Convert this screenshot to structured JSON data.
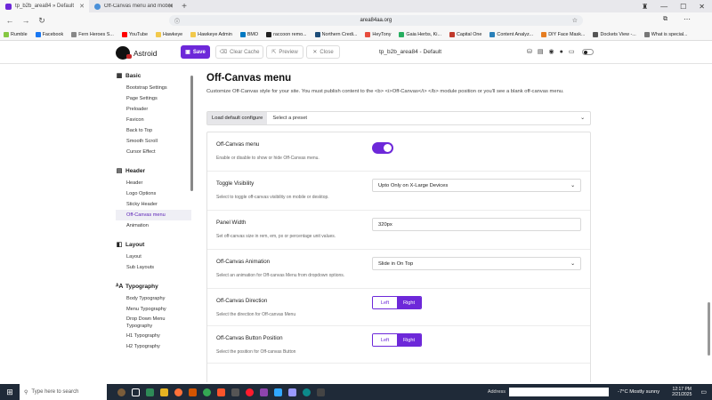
{
  "browser": {
    "tabs": [
      {
        "label": "tp_b2b_area84 » Default",
        "favicon_color": "#6d28d9",
        "active": true
      },
      {
        "label": "Off-Canvas menu and mobile menu...",
        "favicon_color": "#4a90d9",
        "active": false
      }
    ],
    "new_tab": "+",
    "url": "area84aa.org",
    "bookmarks": [
      {
        "label": "Rumble",
        "color": "#85c742"
      },
      {
        "label": "Facebook",
        "color": "#1877f2"
      },
      {
        "label": "Fern Heroes S...",
        "color": "#888888"
      },
      {
        "label": "YouTube",
        "color": "#ff0000"
      },
      {
        "label": "Hawkeye",
        "color": "#f2c94c"
      },
      {
        "label": "Hawkeye Admin",
        "color": "#f2c94c"
      },
      {
        "label": "BMO",
        "color": "#0079c1"
      },
      {
        "label": "raccoon remo...",
        "color": "#222222"
      },
      {
        "label": "Northern Credi...",
        "color": "#1f4e79"
      },
      {
        "label": "HeyTony",
        "color": "#e74c3c"
      },
      {
        "label": "Gaia Herbs, Ki...",
        "color": "#27ae60"
      },
      {
        "label": "Capital One",
        "color": "#c0392b"
      },
      {
        "label": "Content Analyz...",
        "color": "#2980b9"
      },
      {
        "label": "DIY Face Mask...",
        "color": "#e67e22"
      },
      {
        "label": "Dockets View -...",
        "color": "#555555"
      },
      {
        "label": "What is special...",
        "color": "#777777"
      }
    ]
  },
  "app": {
    "logo_text": "Astroid",
    "save_label": "Save",
    "clear_cache_label": "Clear Cache",
    "preview_label": "Preview",
    "close_label": "Close",
    "site_title": "tp_b2b_area84 - Default"
  },
  "sidebar": {
    "groups": [
      {
        "title": "Basic",
        "icon": "sliders-icon",
        "glyph": "▦",
        "items": [
          "Bootstrap Settings",
          "Page Settings",
          "Preloader",
          "Favicon",
          "Back to Top",
          "Smooth Scroll",
          "Cursor Effect"
        ]
      },
      {
        "title": "Header",
        "icon": "header-icon",
        "glyph": "▤",
        "items": [
          "Header",
          "Logo Options",
          "Sticky Header",
          "Off-Canvas menu",
          "Animation"
        ]
      },
      {
        "title": "Layout",
        "icon": "layout-icon",
        "glyph": "◧",
        "items": [
          "Layout",
          "Sub Layouts"
        ]
      },
      {
        "title": "Typography",
        "icon": "typography-icon",
        "glyph": "ᴬA",
        "items": [
          "Body Typography",
          "Menu Typography",
          "Drop Down Menu Typography",
          "H1 Typography",
          "H2 Typography"
        ]
      }
    ],
    "active_item": "Off-Canvas menu"
  },
  "main": {
    "title": "Off-Canvas menu",
    "description": "Customize Off-Canvas style for your site. You must publish content to the <b> <i>Off-Canvas</i> </b> module position or you'll see a blank off-canvas menu.",
    "load_default_label": "Load default configure",
    "preset_placeholder": "Select a preset",
    "settings": [
      {
        "label": "Off-Canvas menu",
        "desc": "Enable or disable to show or hide Off-Canvas menu.",
        "control": "switch",
        "value": true
      },
      {
        "label": "Toggle Visibility",
        "desc": "Select to toggle off-canvas visibility on mobile or desktop.",
        "control": "select",
        "value": "Upto Only on X-Large Devices"
      },
      {
        "label": "Panel Width",
        "desc": "Set off-canvas size in rem, em, px or percentage unit values.",
        "control": "input",
        "value": "320px"
      },
      {
        "label": "Off-Canvas Animation",
        "desc": "Select an animation for Off-canvas Menu from dropdown options.",
        "control": "select",
        "value": "Slide in On Top"
      },
      {
        "label": "Off-Canvas Direction",
        "desc": "Select the direction for Off-canvas Menu",
        "control": "segmented",
        "options": [
          "Left",
          "Right"
        ],
        "value": "Right"
      },
      {
        "label": "Off-Canvas Button Position",
        "desc": "Select the position for Off-canvas Button",
        "control": "segmented",
        "options": [
          "Left",
          "Right"
        ],
        "value": "Right"
      }
    ]
  },
  "taskbar": {
    "search_placeholder": "Type here to search",
    "address_label": "Address",
    "weather": "-7°C  Mostly sunny",
    "time": "12:17 PM",
    "date": "2/21/2025"
  },
  "colors": {
    "accent": "#6d28d9",
    "taskbar": "#1f2a38"
  }
}
